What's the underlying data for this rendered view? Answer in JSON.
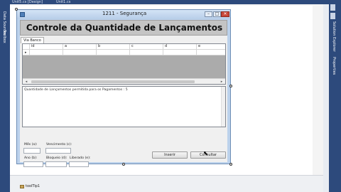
{
  "ide": {
    "top_tabs": [
      "Unit5.cs [Design]",
      "Unit1.cs"
    ],
    "left_rail": [
      "Data Sources",
      "Toolbox"
    ],
    "right_rail": [
      "Solution Explorer",
      "Properties"
    ],
    "tooltip_component": "toolTip1"
  },
  "window": {
    "title": "1211 - Segurança",
    "min_glyph": "–",
    "max_glyph": "□",
    "close_glyph": "✕"
  },
  "form": {
    "header_title": "Controle da Quantidade de Lançamentos",
    "tab_label": "Via Banco",
    "grid": {
      "columns": [
        "id",
        "a",
        "b",
        "c",
        "d",
        "e"
      ],
      "row_marker": "▸"
    },
    "message": "Quantidade de Lançamentos permitida para os Pagamentos : 5",
    "fields": {
      "mes_label": "Mês (a):",
      "vencimento_label": "Vencimento (c):",
      "ano_label": "Ano (b):",
      "bloqueio_label": "Bloqueio (d):",
      "liberado_label": "Liberado (e):"
    },
    "buttons": {
      "insert": "Inserir",
      "consultar": "Consultar"
    }
  },
  "colors": {
    "ide_chrome": "#2d4a7c",
    "window_frame": "#bcd2ec",
    "header_panel": "#c4c4c4",
    "grid_empty": "#ababab",
    "close_button": "#c9483a"
  }
}
